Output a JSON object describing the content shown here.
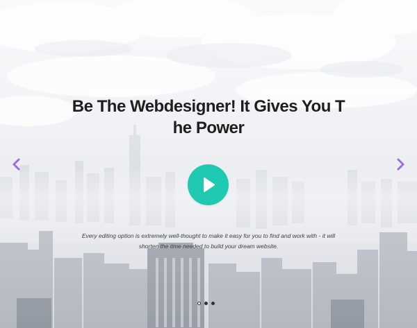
{
  "hero": {
    "headline": "Be The Webdesigner! It Gives You T he Power",
    "description": "Every editing option is extremely well-thought to make it easy for you to find and work with - it will shorten the time needed to build your dream website.",
    "play_icon": "play-icon",
    "prev_icon": "chevron-left-icon",
    "next_icon": "chevron-right-icon",
    "slides_total": 3,
    "active_slide": 1
  },
  "colors": {
    "accent": "#1fc9b1",
    "arrow": "#9b6fd8",
    "headline": "#1e1e1e",
    "text": "#3b3f45"
  }
}
